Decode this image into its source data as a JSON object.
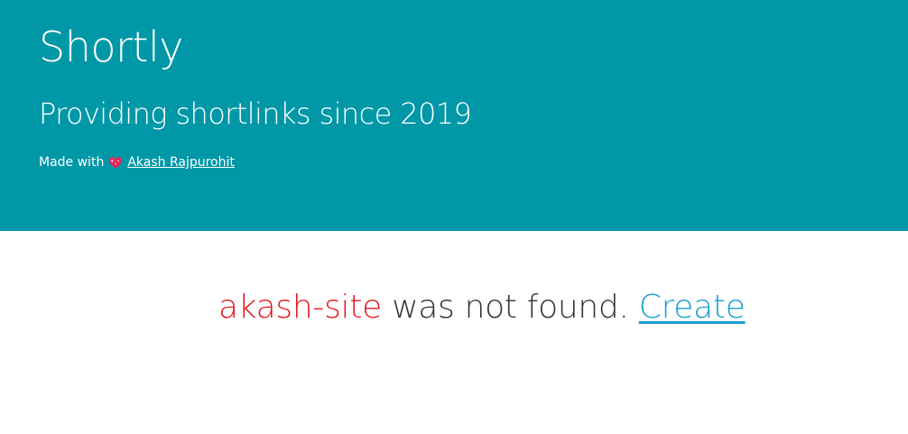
{
  "header": {
    "title": "Shortly",
    "subtitle": "Providing shortlinks since 2019",
    "credit_prefix": "Made with",
    "heart_icon": "sparkling-heart-icon",
    "author_link": "Akash Rajpurohit",
    "background_color": "#0097a7"
  },
  "main": {
    "slug": "akash-site",
    "not_found_text": " was not found. ",
    "create_link": "Create",
    "slug_color": "#e31b23",
    "link_color": "#1a9fd0"
  }
}
